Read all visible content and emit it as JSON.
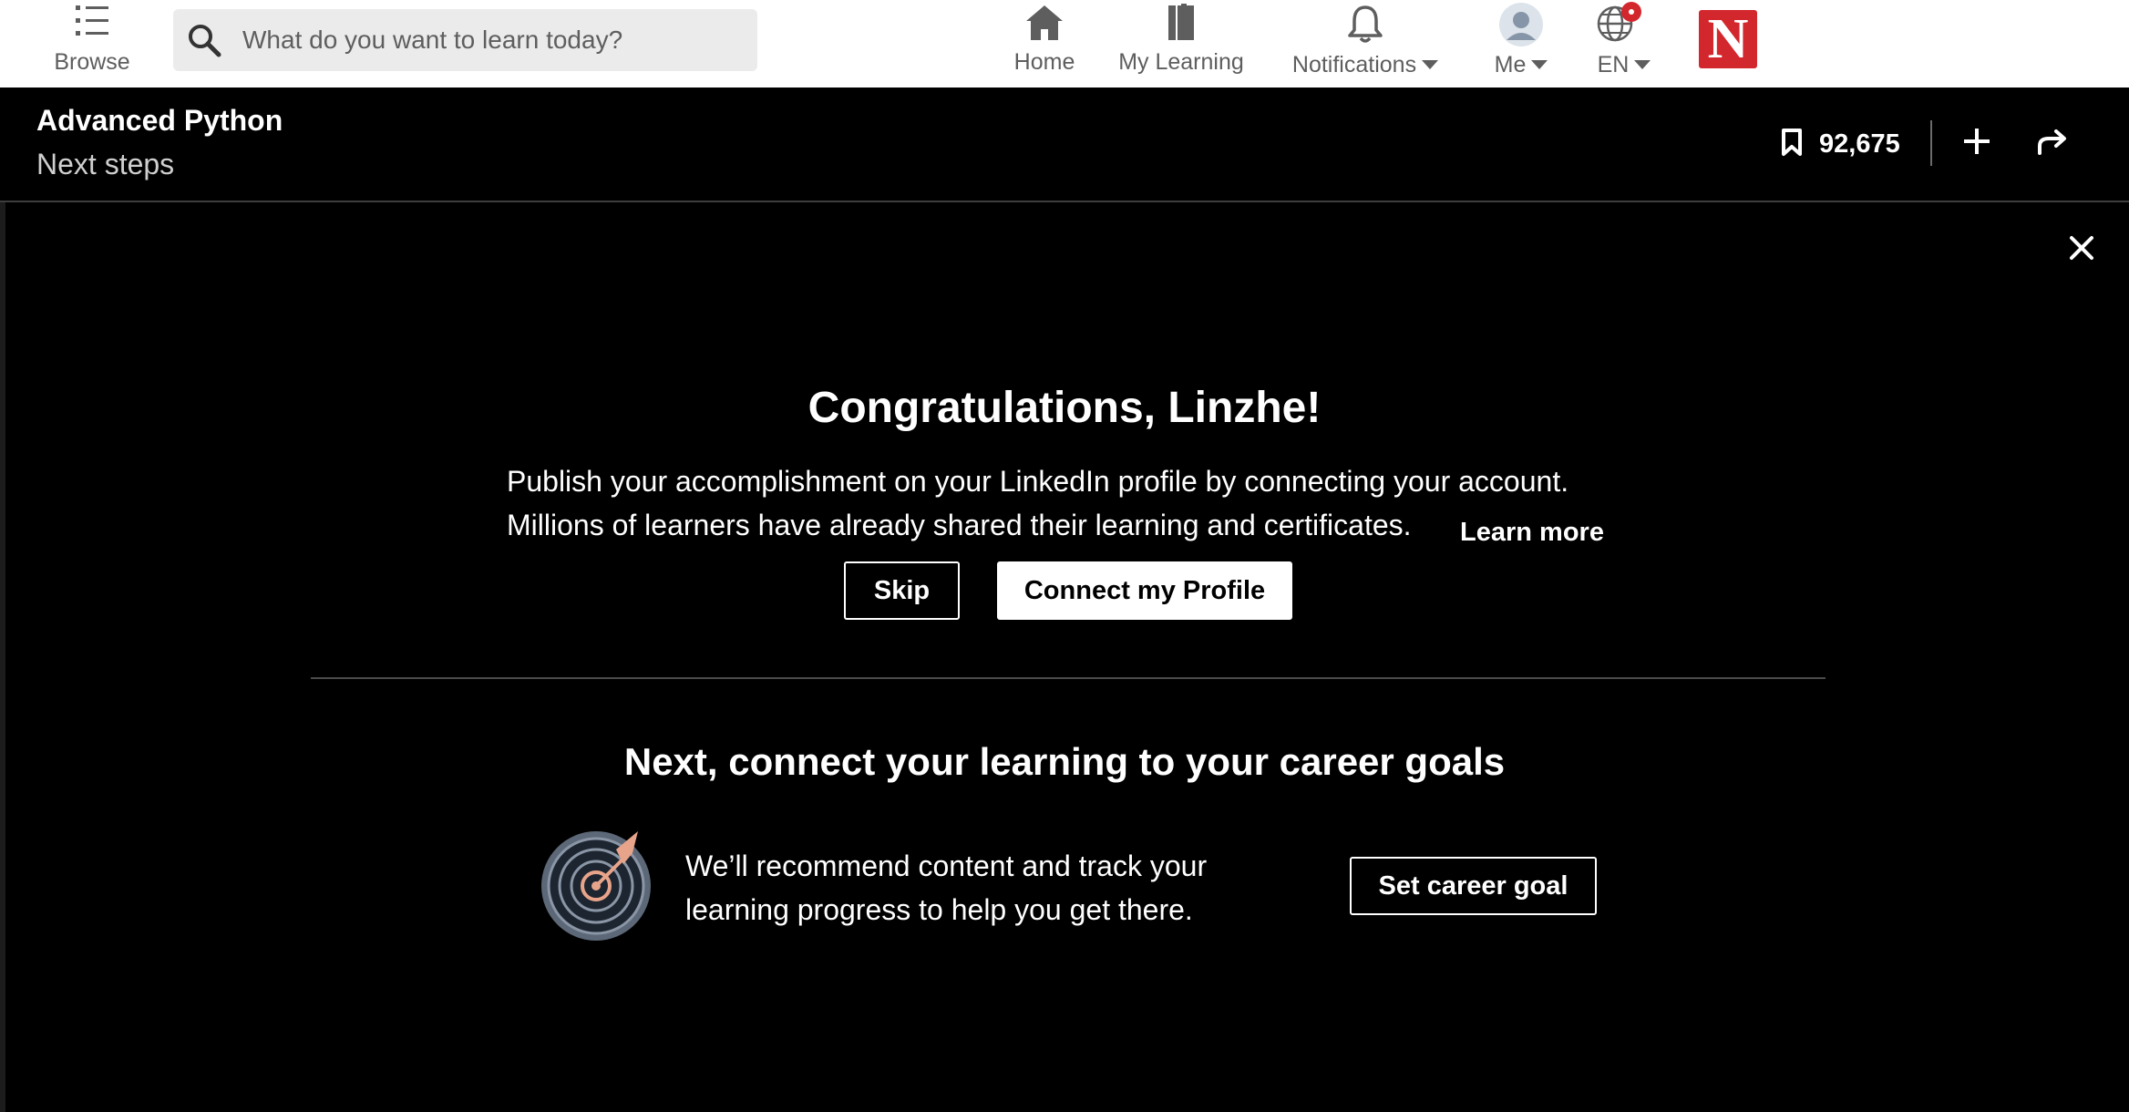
{
  "nav": {
    "browse_label": "Browse",
    "search_placeholder": "What do you want to learn today?",
    "home_label": "Home",
    "my_learning_label": "My Learning",
    "notifications_label": "Notifications",
    "me_label": "Me",
    "language_label": "EN",
    "logo_letter": "N",
    "icons": [
      "list-icon",
      "search-icon",
      "home-icon",
      "book-icon",
      "bell-icon",
      "avatar",
      "globe-icon"
    ]
  },
  "course": {
    "title": "Advanced Python",
    "subtitle": "Next steps",
    "saves_count": "92,675"
  },
  "modal": {
    "heading": "Congratulations, Linzhe!",
    "line1": "Publish your accomplishment on your LinkedIn profile by connecting your account.",
    "line2": "Millions of learners have already shared their learning and certificates.",
    "learn_more": "Learn more",
    "skip_label": "Skip",
    "connect_label": "Connect my Profile",
    "next_heading": "Next, connect your learning to your career goals",
    "rec_line1": "We’ll recommend content and track your",
    "rec_line2": "learning progress to help you get there.",
    "career_label": "Set career goal"
  },
  "colors": {
    "brand_red": "#d3272e",
    "notification_badge": "#d3272e",
    "target_accent": "#e8a48a",
    "background": "#000000"
  }
}
